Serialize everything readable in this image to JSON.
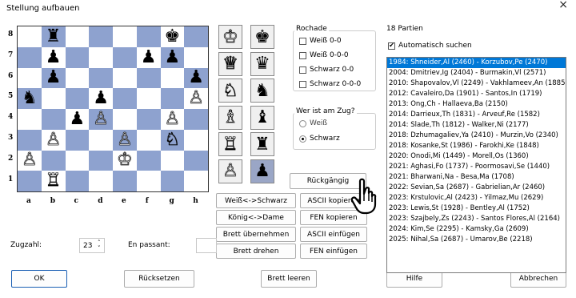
{
  "window": {
    "title": "Stellung aufbauen",
    "close": "×"
  },
  "board": {
    "ranks": [
      "8",
      "7",
      "6",
      "5",
      "4",
      "3",
      "2",
      "1"
    ],
    "files": [
      "a",
      "b",
      "c",
      "d",
      "e",
      "f",
      "g",
      "h"
    ],
    "rows": [
      [
        "",
        "r",
        "",
        "",
        "",
        "",
        "k",
        ""
      ],
      [
        "",
        "p",
        "",
        "",
        "",
        "p",
        "p",
        ""
      ],
      [
        "",
        "p",
        "",
        "",
        "",
        "",
        "",
        "p"
      ],
      [
        "n",
        "",
        "",
        "p",
        "",
        "",
        "",
        "P"
      ],
      [
        "",
        "",
        "p",
        "P",
        "",
        "",
        "P",
        ""
      ],
      [
        "",
        "P",
        "",
        "",
        "P",
        "",
        "N",
        ""
      ],
      [
        "P",
        "",
        "",
        "",
        "K",
        "",
        "",
        ""
      ],
      [
        "",
        "R",
        "",
        "",
        "",
        "",
        "",
        ""
      ]
    ]
  },
  "pieces": {
    "K": "♔",
    "Q": "♕",
    "R": "♖",
    "B": "♗",
    "N": "♘",
    "P": "♙",
    "k": "♚",
    "q": "♛",
    "r": "♜",
    "b": "♝",
    "n": "♞",
    "p": "♟"
  },
  "palette": {
    "white": [
      "♔",
      "♕",
      "♘",
      "♗",
      "♖",
      "♙"
    ],
    "black": [
      "♚",
      "♛",
      "♞",
      "♝",
      "♜",
      "♟"
    ],
    "selected": "black-pawn"
  },
  "castling": {
    "title": "Rochade",
    "options": [
      "Weiß 0-0",
      "Weiß 0-0-0",
      "Schwarz 0-0",
      "Schwarz 0-0-0"
    ]
  },
  "to_move": {
    "title": "Wer ist am Zug?",
    "options": [
      "Weiß",
      "Schwarz"
    ],
    "selected": "Schwarz"
  },
  "buttons": {
    "undo": "Rückgängig",
    "swap_colors": "Weiß<->Schwarz",
    "ascii_copy": "ASCII kopieren",
    "king_queen": "König<->Dame",
    "fen_copy": "FEN kopieren",
    "take_board": "Brett übernehmen",
    "ascii_paste": "ASCII einfügen",
    "rotate_board": "Brett drehen",
    "fen_paste": "FEN einfügen",
    "ok": "OK",
    "reset": "Rücksetzen",
    "clear_board": "Brett leeren",
    "help": "Hilfe",
    "cancel": "Abbrechen"
  },
  "move_number": {
    "label": "Zugzahl:",
    "value": "23",
    "up": "˄",
    "down": "˅"
  },
  "en_passant": {
    "label": "En passant:",
    "value": ""
  },
  "games": {
    "count": "18 Partien",
    "auto_search": "Automatisch suchen",
    "items": [
      "1984: Shneider,Al (2460) - Korzubov,Pe (2470)",
      "2004: Dmitriev,Ig (2404) - Burmakin,Vl (2571)",
      "2010: Shapovalov,Vl (2249) - Vakhlameev,An (1885)",
      "2012: Cavaleiro,Da (1901) - Santos,In (1719)",
      "2013: Ong,Ch - Hallaeva,Ba (2150)",
      "2014: Darrieux,Th (1831) - Arveuf,Re (1582)",
      "2014: Slade,Th (1812) - Walker,Ni (2177)",
      "2018: Dzhumagaliev,Ya (2410) - Murzin,Vo (2340)",
      "2018: Kosanke,St (1986) - Farokhi,Ke (1848)",
      "2020: Onodi,Mi (1449) - Morell,Os (1360)",
      "2021: Aghasi,Fo (1737) - Poormosavi,Se (1440)",
      "2021: Bharwani,Na - Besa,Ma (1708)",
      "2022: Sevian,Sa (2687) - Gabrielian,Ar (2460)",
      "2023: Krstulovic,Al (2423) - Yilmaz,Mu (2629)",
      "2023: Lewis,St (1928) - Bentley,Al (1752)",
      "2023: Szajbely,Zs (2243) - Santos Flores,Al (2164)",
      "2024: Kim,Se (2295) - Kamsky,Ga (2609)",
      "2025: Nihal,Sa (2687) - Umarov,Be (2218)"
    ],
    "selected_index": 0
  },
  "colors": {
    "dark_square": "#8ea2cf",
    "selection": "#0078d7",
    "palette_selected": "#9aa6c6"
  }
}
